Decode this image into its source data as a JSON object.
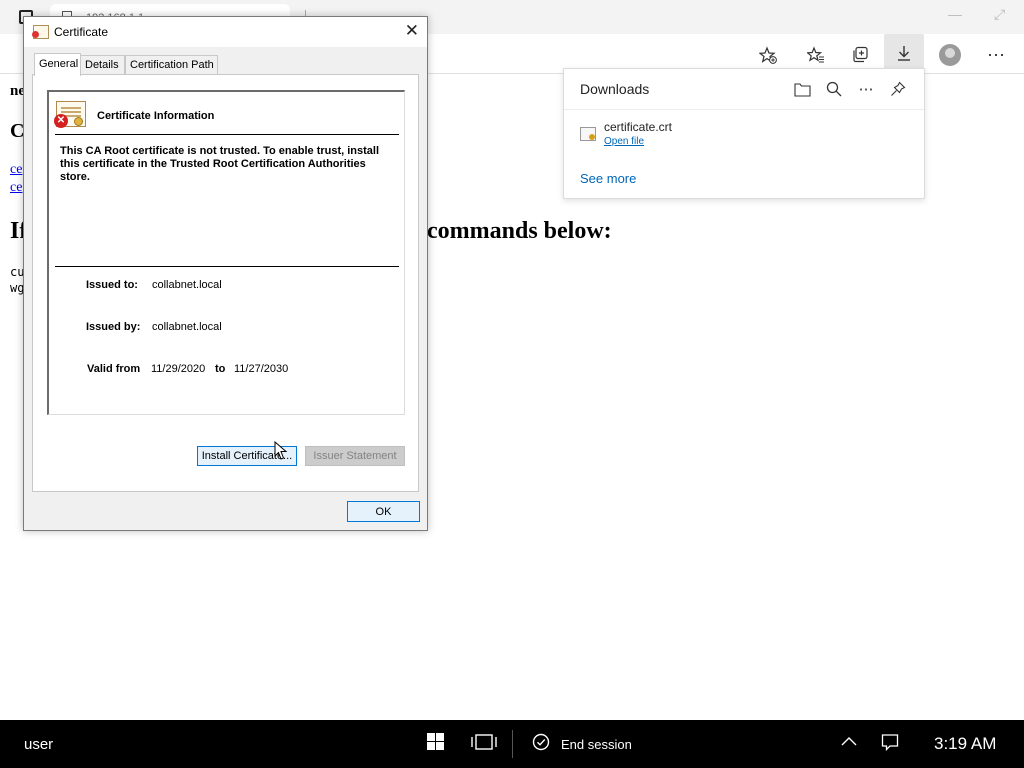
{
  "browser": {
    "tab_title": "192.168.1.1",
    "tab_close": "⌄",
    "toolbar": {
      "favorite_add_icon": "star-plus-icon",
      "favorites_icon": "favorites-list-icon",
      "collections_icon": "collections-icon",
      "downloads_icon": "download-arrow-icon",
      "profile_icon": "profile-avatar-icon",
      "menu_glyph": "⋯"
    },
    "window_controls": {
      "minimize": "—",
      "maximize": "⤢"
    }
  },
  "page": {
    "line1": "ne",
    "heading1": "C",
    "link1": "ce",
    "link2": "ce",
    "heading2_start": "If",
    "heading2_end": "commands below:",
    "code1": "cu",
    "code2": "wg"
  },
  "downloads": {
    "title": "Downloads",
    "icons": [
      "folder-icon",
      "search-icon",
      "more-icon",
      "pin-icon"
    ],
    "file_name": "certificate.crt",
    "open_file": "Open file",
    "see_more": "See more"
  },
  "dialog": {
    "title": "Certificate",
    "close_glyph": "✕",
    "tabs": [
      "General",
      "Details",
      "Certification Path"
    ],
    "info_title": "Certificate Information",
    "warning": "This CA Root certificate is not trusted. To enable trust, install this certificate in the Trusted Root Certification Authorities store.",
    "issued_to_label": "Issued to:",
    "issued_to": "collabnet.local",
    "issued_by_label": "Issued by:",
    "issued_by": "collabnet.local",
    "valid_from_label": "Valid from",
    "valid_from": "11/29/2020",
    "to_label": "to",
    "valid_to": "11/27/2030",
    "install_button": "Install Certificate...",
    "issuer_button": "Issuer Statement",
    "ok_button": "OK"
  },
  "taskbar": {
    "user": "user",
    "end_session": "End session",
    "time": "3:19 AM"
  }
}
